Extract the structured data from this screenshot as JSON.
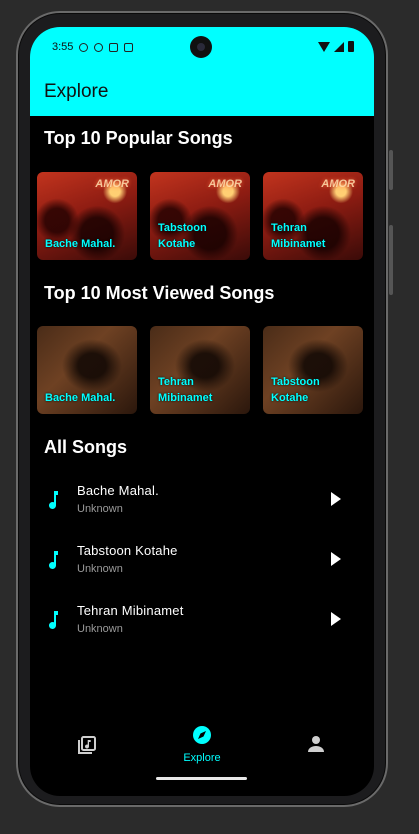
{
  "status_bar": {
    "time": "3:55"
  },
  "app_bar": {
    "title": "Explore"
  },
  "sections": {
    "popular_title": "Top 10 Popular Songs",
    "viewed_title": "Top 10 Most Viewed Songs",
    "all_title": "All Songs"
  },
  "popular": [
    {
      "label": "Bache Mahal.",
      "neon": "AMOR"
    },
    {
      "label": "Tabstoon Kotahe",
      "neon": "AMOR"
    },
    {
      "label": "Tehran Mibinamet",
      "neon": "AMOR"
    }
  ],
  "viewed": [
    {
      "label": "Bache Mahal."
    },
    {
      "label": "Tehran Mibinamet"
    },
    {
      "label": "Tabstoon Kotahe"
    }
  ],
  "songs": [
    {
      "title": "Bache Mahal.",
      "artist": "Unknown"
    },
    {
      "title": "Tabstoon Kotahe",
      "artist": "Unknown"
    },
    {
      "title": "Tehran Mibinamet",
      "artist": "Unknown"
    }
  ],
  "nav": {
    "explore_label": "Explore",
    "icons": [
      "library-music-icon",
      "compass-icon",
      "person-icon"
    ]
  },
  "colors": {
    "accent": "#00ffff",
    "background": "#000000",
    "text": "#ffffff",
    "muted": "#9a9a9a"
  }
}
